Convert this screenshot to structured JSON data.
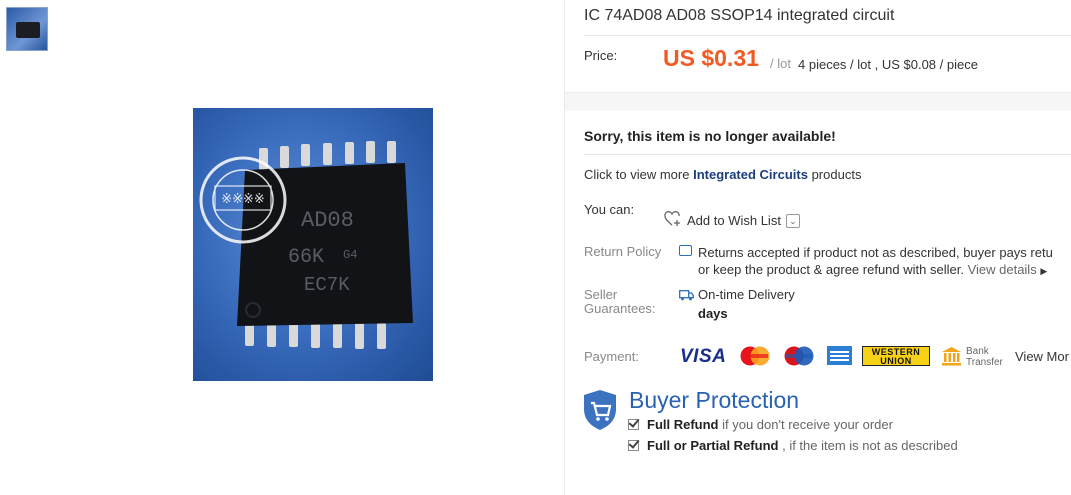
{
  "product": {
    "title": "IC 74AD08 AD08 SSOP14 integrated circuit",
    "chip_marking": [
      "AD08",
      "66K",
      "G4",
      "EC7K"
    ]
  },
  "price": {
    "label": "Price:",
    "value": "US $0.31",
    "unit": "/ lot",
    "extra": "4 pieces / lot , US $0.08 / piece"
  },
  "availability": {
    "sorry": "Sorry, this item is no longer available!",
    "more_prefix": "Click to view more",
    "more_link": "Integrated Circuits",
    "more_suffix": "products"
  },
  "actions": {
    "you_can_label": "You can:",
    "wishlist": "Add to Wish List"
  },
  "return_policy": {
    "label": "Return Policy",
    "line1": "Returns accepted if product not as described, buyer pays retu",
    "line2": "or keep the product & agree refund with seller.",
    "view_details": "View details"
  },
  "seller": {
    "label_line1": "Seller",
    "label_line2": "Guarantees:",
    "delivery": "On-time Delivery",
    "days": "days"
  },
  "payment": {
    "label": "Payment:",
    "visa": "VISA",
    "western_union_line1": "WESTERN",
    "western_union_line2": "UNION",
    "bank_line1": "Bank",
    "bank_line2": "Transfer",
    "view_more": "View Mor"
  },
  "buyer_protection": {
    "title": "Buyer Protection",
    "full_refund": "Full Refund",
    "full_refund_sub": "if you don't receive your order",
    "partial_refund": "Full or Partial Refund",
    "partial_refund_sub": ", if the item is not as described"
  },
  "icons": [
    "heart-plus-icon",
    "chevron-down-icon",
    "return-icon",
    "delivery-truck-icon",
    "chevron-right-icon",
    "bank-icon",
    "shield-cart-icon",
    "checkbox-icon"
  ],
  "colors": {
    "price": "#f15a22",
    "link": "#1c3f7c",
    "bp_blue": "#2a62b3",
    "visa_blue": "#1a2e8c"
  }
}
